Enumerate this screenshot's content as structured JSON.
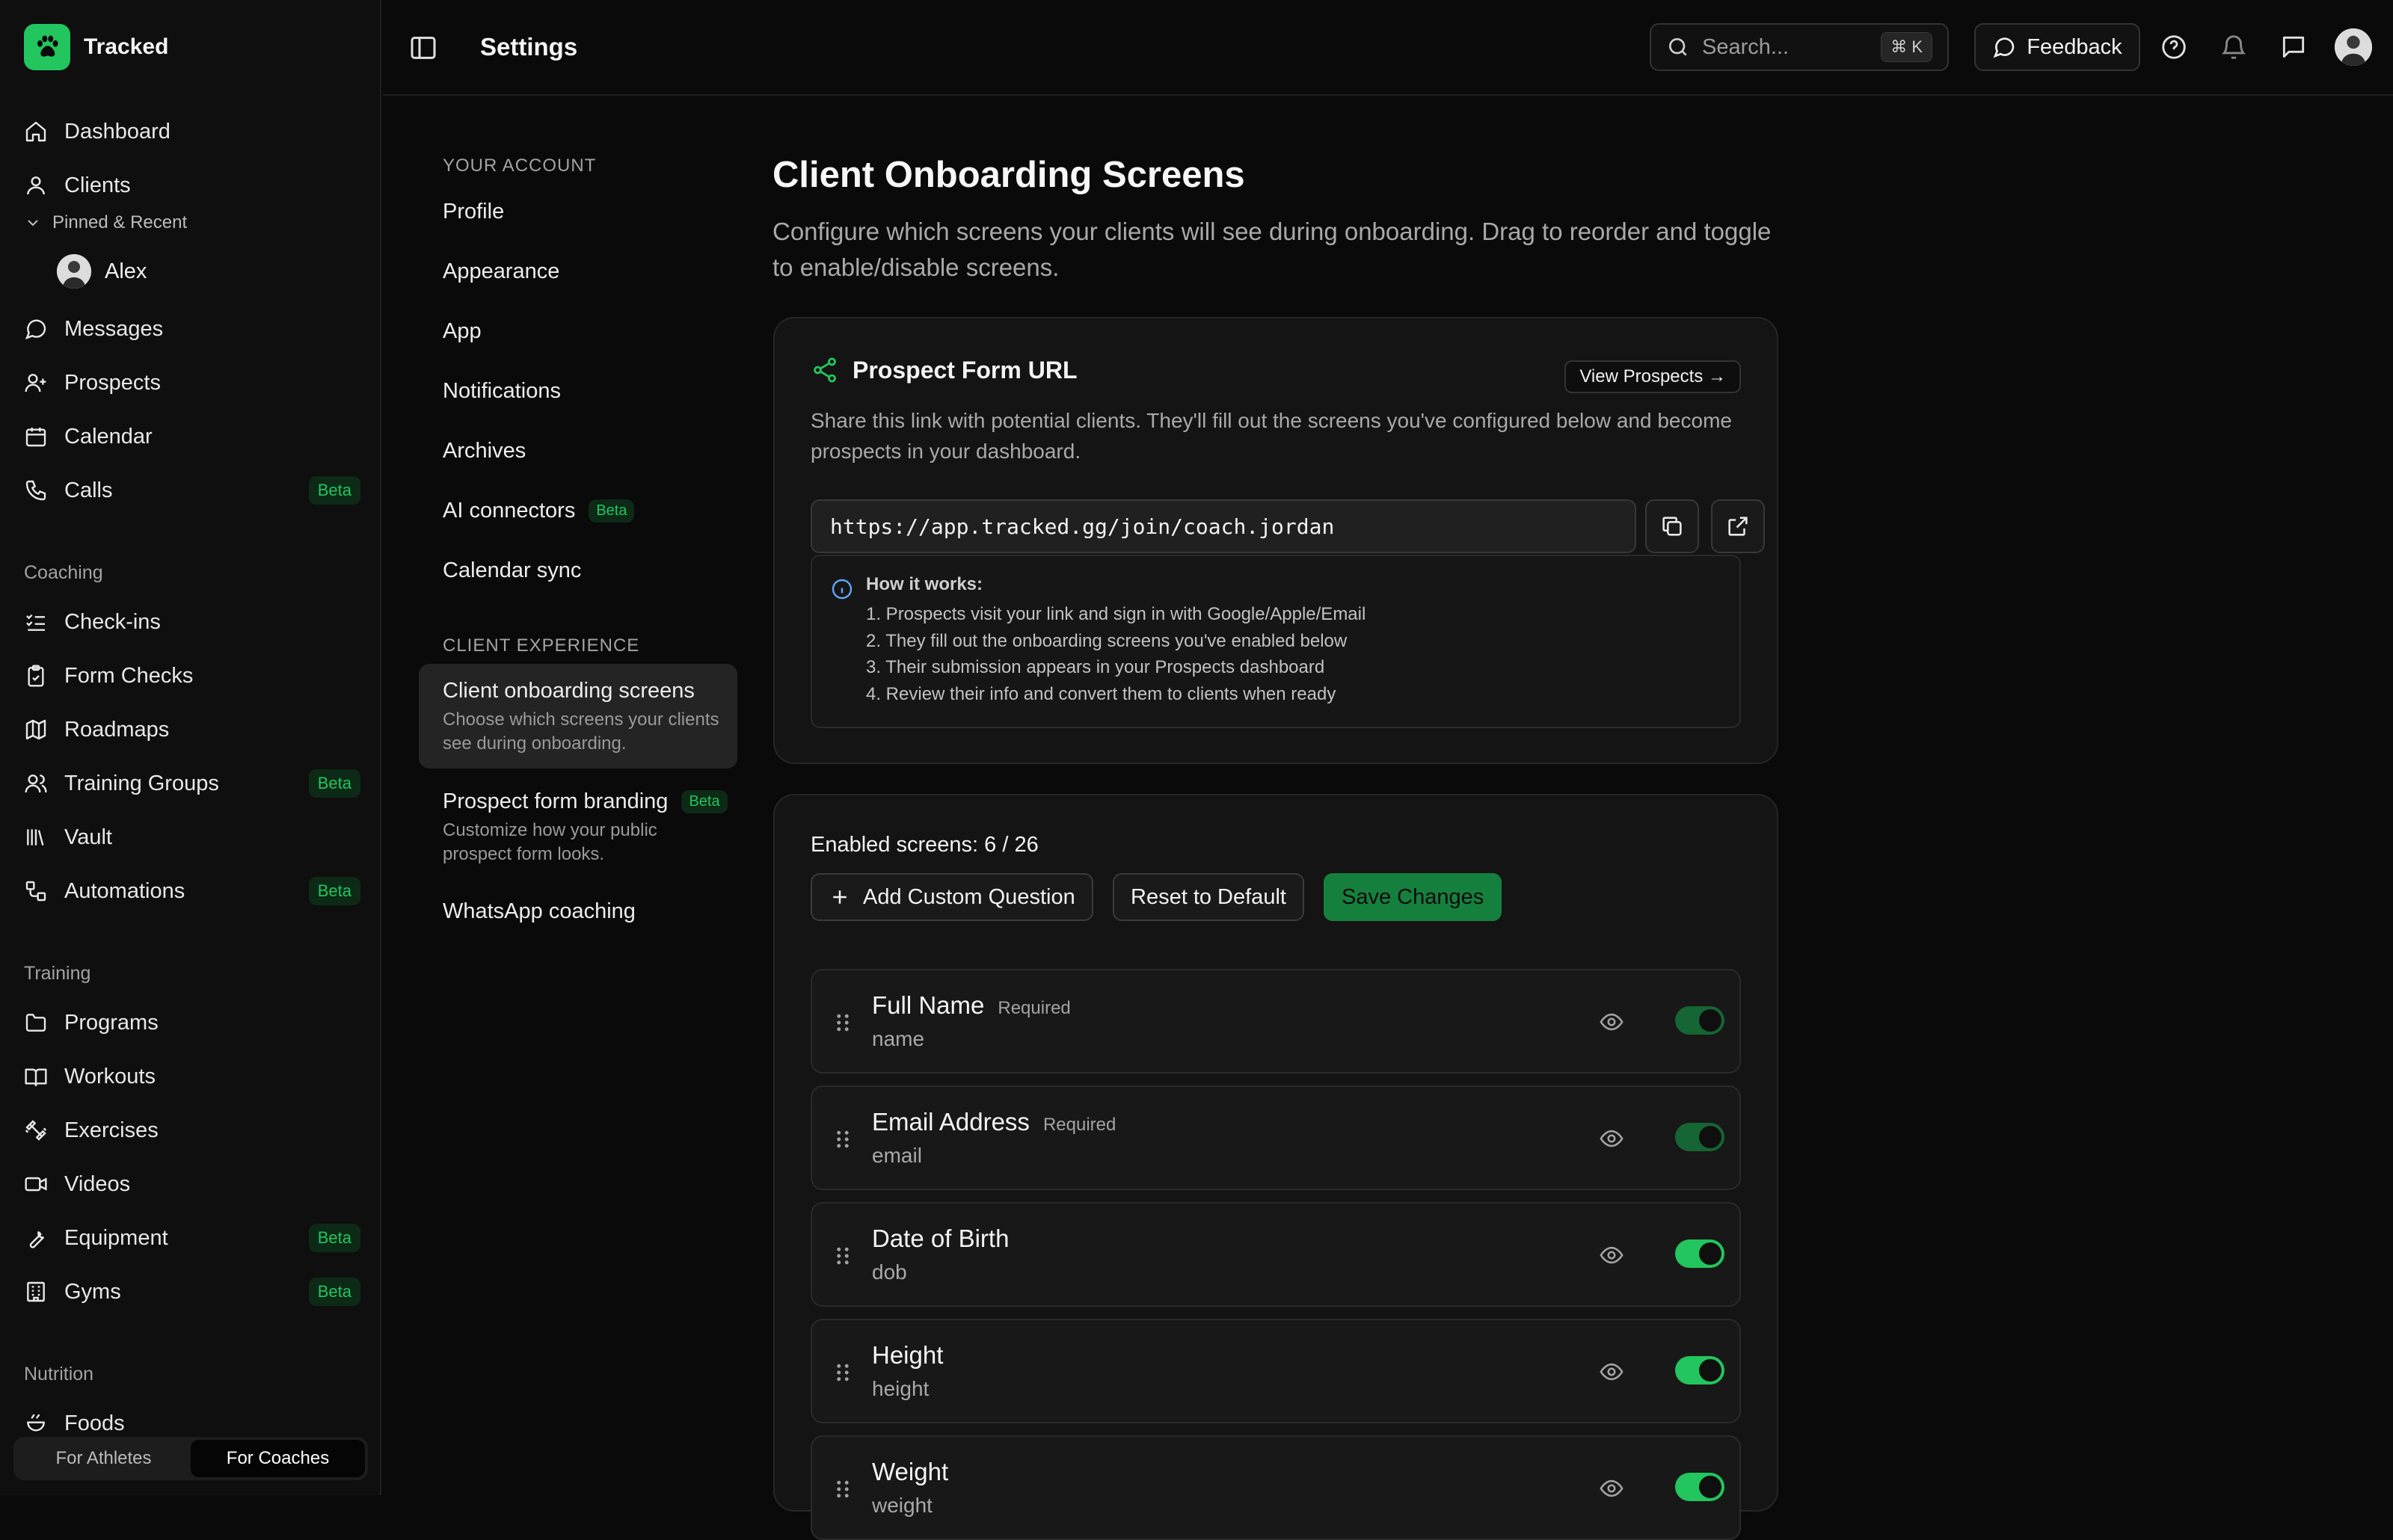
{
  "brand": {
    "name": "Tracked"
  },
  "sidebar": {
    "items": [
      {
        "label": "Dashboard",
        "icon": "home-icon"
      },
      {
        "label": "Clients",
        "icon": "user-icon"
      },
      {
        "label": "Messages",
        "icon": "message-icon"
      },
      {
        "label": "Prospects",
        "icon": "user-plus-icon"
      },
      {
        "label": "Calendar",
        "icon": "calendar-icon"
      },
      {
        "label": "Calls",
        "icon": "phone-icon",
        "badge": "Beta"
      }
    ],
    "pinned_label": "Pinned & Recent",
    "pinned_user": "Alex",
    "coaching_label": "Coaching",
    "coaching": [
      {
        "label": "Check-ins",
        "icon": "checklist-icon"
      },
      {
        "label": "Form Checks",
        "icon": "clipboard-icon"
      },
      {
        "label": "Roadmaps",
        "icon": "map-icon"
      },
      {
        "label": "Training Groups",
        "icon": "users-icon",
        "badge": "Beta"
      },
      {
        "label": "Vault",
        "icon": "library-icon"
      },
      {
        "label": "Automations",
        "icon": "workflow-icon",
        "badge": "Beta"
      }
    ],
    "training_label": "Training",
    "training": [
      {
        "label": "Programs",
        "icon": "folder-icon"
      },
      {
        "label": "Workouts",
        "icon": "book-icon"
      },
      {
        "label": "Exercises",
        "icon": "dumbbell-icon"
      },
      {
        "label": "Videos",
        "icon": "video-icon"
      },
      {
        "label": "Equipment",
        "icon": "wrench-icon",
        "badge": "Beta"
      },
      {
        "label": "Gyms",
        "icon": "building-icon",
        "badge": "Beta"
      }
    ],
    "nutrition_label": "Nutrition",
    "nutrition": [
      {
        "label": "Foods",
        "icon": "food-icon"
      }
    ],
    "switch": {
      "athletes": "For Athletes",
      "coaches": "For Coaches",
      "selected": "For Coaches"
    }
  },
  "topbar": {
    "title": "Settings",
    "search_placeholder": "Search...",
    "search_shortcut": "⌘ K",
    "feedback_label": "Feedback"
  },
  "settings_nav": {
    "account_label": "YOUR ACCOUNT",
    "account": [
      "Profile",
      "Appearance",
      "App",
      "Notifications",
      "Archives",
      "AI connectors",
      "Calendar sync"
    ],
    "ai_badge": "Beta",
    "client_label": "CLIENT EXPERIENCE",
    "client": [
      {
        "label": "Client onboarding screens",
        "desc": "Choose which screens your clients see during onboarding.",
        "active": true
      },
      {
        "label": "Prospect form branding",
        "desc": "Customize how your public prospect form looks.",
        "badge": "Beta"
      },
      {
        "label": "WhatsApp coaching"
      }
    ]
  },
  "main": {
    "title": "Client Onboarding Screens",
    "description": "Configure which screens your clients will see during onboarding. Drag to reorder and toggle to enable/disable screens.",
    "prospect_card": {
      "title": "Prospect Form URL",
      "view_button": "View Prospects →",
      "description": "Share this link with potential clients. They'll fill out the screens you've configured below and become prospects in your dashboard.",
      "url": "https://app.tracked.gg/join/coach.jordan",
      "how_title": "How it works:",
      "steps": [
        "1. Prospects visit your link and sign in with Google/Apple/Email",
        "2. They fill out the onboarding screens you've enabled below",
        "3. Their submission appears in your Prospects dashboard",
        "4. Review their info and convert them to clients when ready"
      ]
    },
    "screens": {
      "enabled_text": "Enabled screens: 6 / 26",
      "add_button": "Add Custom Question",
      "reset_button": "Reset to Default",
      "save_button": "Save Changes",
      "rows": [
        {
          "name": "Full Name",
          "key": "name",
          "required": "Required",
          "enabled": true,
          "locked": true
        },
        {
          "name": "Email Address",
          "key": "email",
          "required": "Required",
          "enabled": true,
          "locked": true
        },
        {
          "name": "Date of Birth",
          "key": "dob",
          "required": "",
          "enabled": true,
          "locked": false
        },
        {
          "name": "Height",
          "key": "height",
          "required": "",
          "enabled": true,
          "locked": false
        },
        {
          "name": "Weight",
          "key": "weight",
          "required": "",
          "enabled": true,
          "locked": false
        }
      ]
    }
  },
  "colors": {
    "accent": "#22c55e",
    "accent_dark": "#15803d",
    "background": "#0a0a0a"
  }
}
